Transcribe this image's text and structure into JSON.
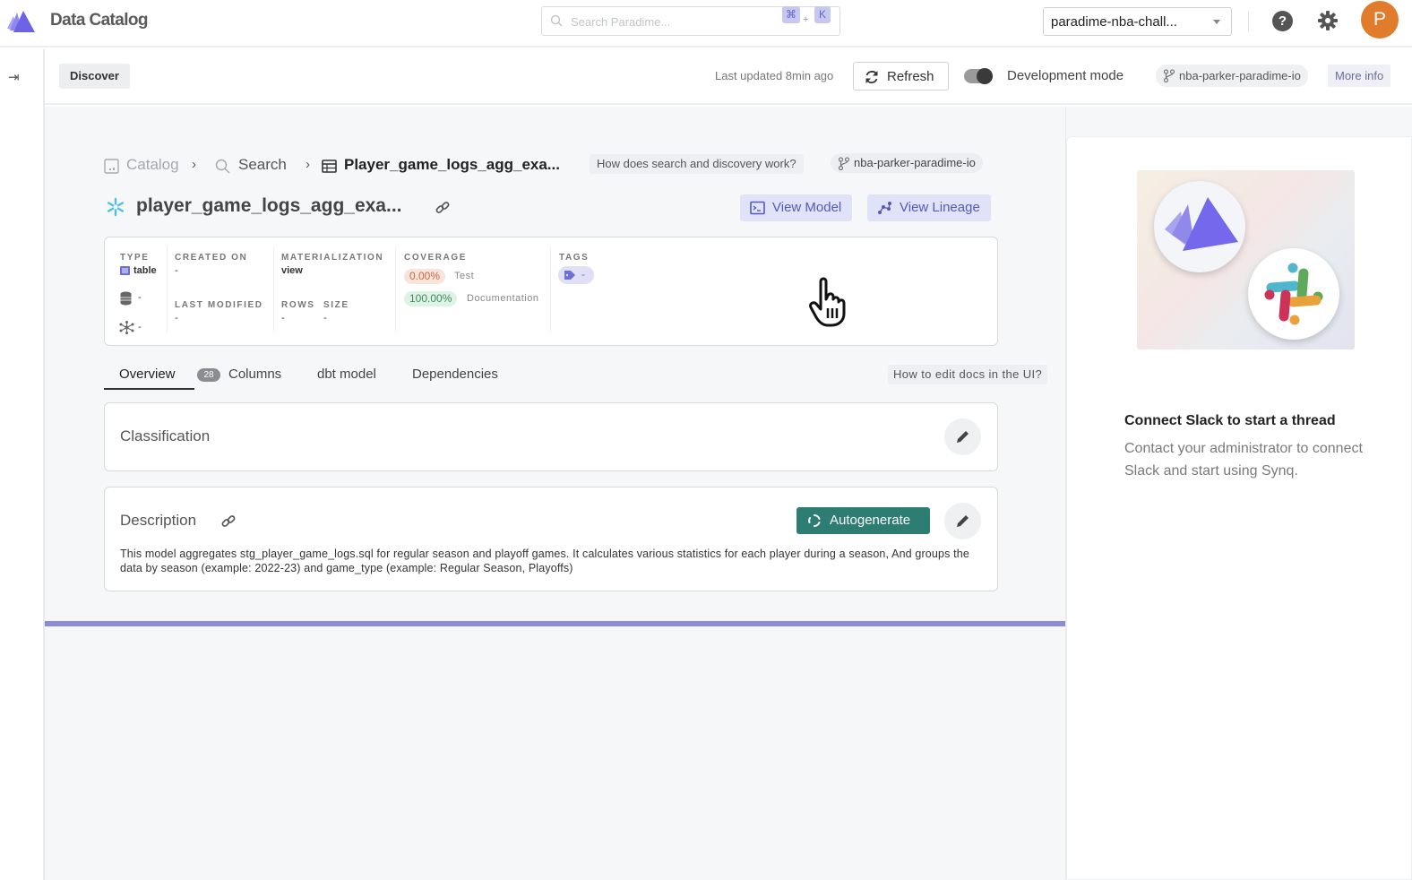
{
  "header": {
    "app_title": "Data Catalog",
    "search_placeholder": "Search Paradime...",
    "shortcut_keys": [
      "⌘",
      "K"
    ],
    "shortcut_plus": "+",
    "workspace_selected": "paradime-nba-chall...",
    "avatar_initial": "P",
    "avatar_color": "#e07c2c",
    "help_glyph": "?"
  },
  "rail": {
    "collapse_glyph": "⇥"
  },
  "toolbar": {
    "discover_label": "Discover",
    "last_updated": "Last updated 8min ago",
    "refresh_label": "Refresh",
    "dev_mode_label": "Development mode",
    "dev_mode_on": true,
    "branch": "nba-parker-paradime-io",
    "more_info_label": "More info"
  },
  "breadcrumb": {
    "items": [
      {
        "label": "Catalog",
        "icon": "catalog-icon"
      },
      {
        "label": "Search",
        "icon": "search-icon"
      },
      {
        "label": "Player_game_logs_agg_exa...",
        "icon": "table-icon"
      }
    ],
    "separator": "›",
    "help_link": "How does search and discovery work?",
    "branch": "nba-parker-paradime-io"
  },
  "model": {
    "title": "player_game_logs_agg_exa...",
    "view_model_label": "View Model",
    "view_lineage_label": "View Lineage"
  },
  "metadata": {
    "type_label": "TYPE",
    "type_value": "table",
    "database_value": "-",
    "schema_value": "-",
    "created_on_label": "CREATED ON",
    "created_on_value": "-",
    "last_modified_label": "LAST MODIFIED",
    "last_modified_value": "-",
    "materialization_label": "MATERIALIZATION",
    "materialization_value": "view",
    "rows_label": "ROWS",
    "rows_value": "-",
    "size_label": "SIZE",
    "size_value": "-",
    "coverage_label": "COVERAGE",
    "coverage": [
      {
        "value": "0.00%",
        "note": "Test",
        "status": "bad"
      },
      {
        "value": "100.00%",
        "note": "Documentation",
        "status": "good"
      }
    ],
    "tags_label": "TAGS",
    "tags_value": "-"
  },
  "tabs": {
    "items": [
      {
        "label": "Overview",
        "active": true
      },
      {
        "label": "Columns",
        "badge": "28"
      },
      {
        "label": "dbt model"
      },
      {
        "label": "Dependencies"
      }
    ],
    "help_link": "How to edit docs in the UI?"
  },
  "classification": {
    "title": "Classification"
  },
  "description": {
    "title": "Description",
    "autogenerate_label": "Autogenerate",
    "text": "This model aggregates stg_player_game_logs.sql for regular season and playoff games. It calculates various statistics for each player during a season, And groups the data by season (example: 2022-23) and game_type (example: Regular Season, Playoffs)"
  },
  "loading": {
    "progress_percent": 100
  },
  "slack_panel": {
    "title": "Connect Slack to start a thread",
    "text": "Contact your administrator to connect Slack and start using Synq."
  },
  "colors": {
    "brand_purple": "#7b6ff0",
    "accent_teal": "#2e7d72",
    "action_bg": "#e0e2f7",
    "action_text": "#5759b6",
    "progress": "#8b8bd6"
  }
}
